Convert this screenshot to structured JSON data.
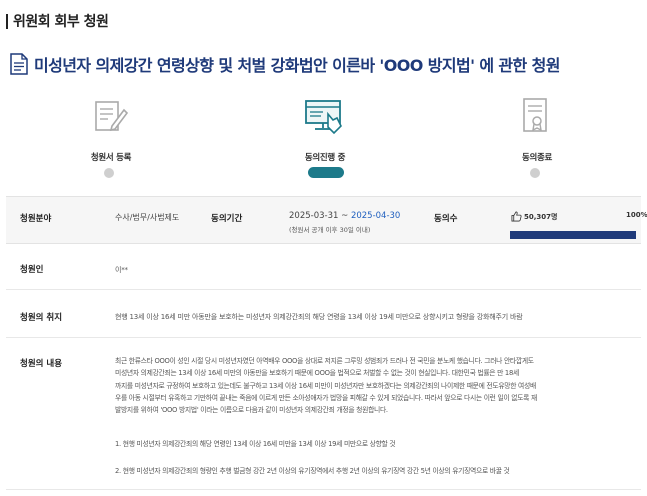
{
  "header": {
    "section_title": "위원회 회부 청원"
  },
  "petition": {
    "title": "미성년자 의제강간 연령상향 및 처벌 강화법안 이른바 'OOO 방지법' 에 관한 청원"
  },
  "stepper": {
    "steps": [
      {
        "label": "청원서 등록",
        "icon": "document-edit-icon",
        "state": "done"
      },
      {
        "label": "동의진행 중",
        "icon": "monitor-hand-icon",
        "state": "active"
      },
      {
        "label": "동의종료",
        "icon": "certificate-icon",
        "state": "pending"
      }
    ]
  },
  "info": {
    "field_label": "청원분야",
    "field_value": "수사/법무/사법제도",
    "period_label": "동의기간",
    "period_start": "2025-03-31 ~ ",
    "period_end": "2025-04-30",
    "period_note": "(청원서 공개 이후 30일 이내)",
    "agree_label": "동의수",
    "agree_count": "50,307명",
    "agree_percent": "100%",
    "agree_progress": 1.0,
    "progress_color": "#1f3a7a"
  },
  "petitioner": {
    "label": "청원인",
    "value": "이**"
  },
  "purpose": {
    "label": "청원의 취지",
    "text": "현행 13세 이상 16세 미만 아동만을 보호하는 미성년자 의제강간죄의 해당 연령을 13세 이상 19세 미만으로 상향시키고 형량을 강화해주기 바람"
  },
  "content": {
    "label": "청원의 내용",
    "lines": [
      "최근 한류스타 OOO이 성인 시절 당시 미성년자였던 아역배우 OOO을 상대로 저지른 그루밍 성범죄가 드러나 전 국민을 분노케 했습니다. 그러나 안타깝게도",
      "미성년자 의제강간죄는 13세 이상 16세 미만의 아동만을 보호하기 때문에 OOO을 법적으로 처벌할 수 없는 것이 현실입니다. 대한민국 법률은 만 18세",
      "까지를 미성년자로 규정하여 보호하고 있는데도 불구하고 13세 이상 16세 미만이 미성년자만 보호하겠다는 의제강간죄의 나이제한 때문에 전도유망한 여성배",
      "우를 아동 시절부터 유혹하고 기만하여 끝내는 죽음에 이르게 만든 소아성애자가 법망을 피해갈 수 있게 되었습니다. 따라서 앞으로 다시는 이런 일이 없도록 재",
      "발방지를 위하여 'OOO 방지법' 이라는 이름으로 다음과 같이 미성년자 의제강간죄 개정을 청원합니다."
    ],
    "items": [
      "1. 현행 미성년자 의제강간죄의 해당 연령인 13세 이상 16세 미만을 13세 이상 19세 미만으로 상향할 것",
      "2. 현행 미성년자 의제강간죄의 형량인 추행 벌금형 강간 2년 이상의 유기징역에서 추행 2년 이상의 유기징역 강간 5년 이상의 유기징역으로 바꿀 것"
    ]
  }
}
